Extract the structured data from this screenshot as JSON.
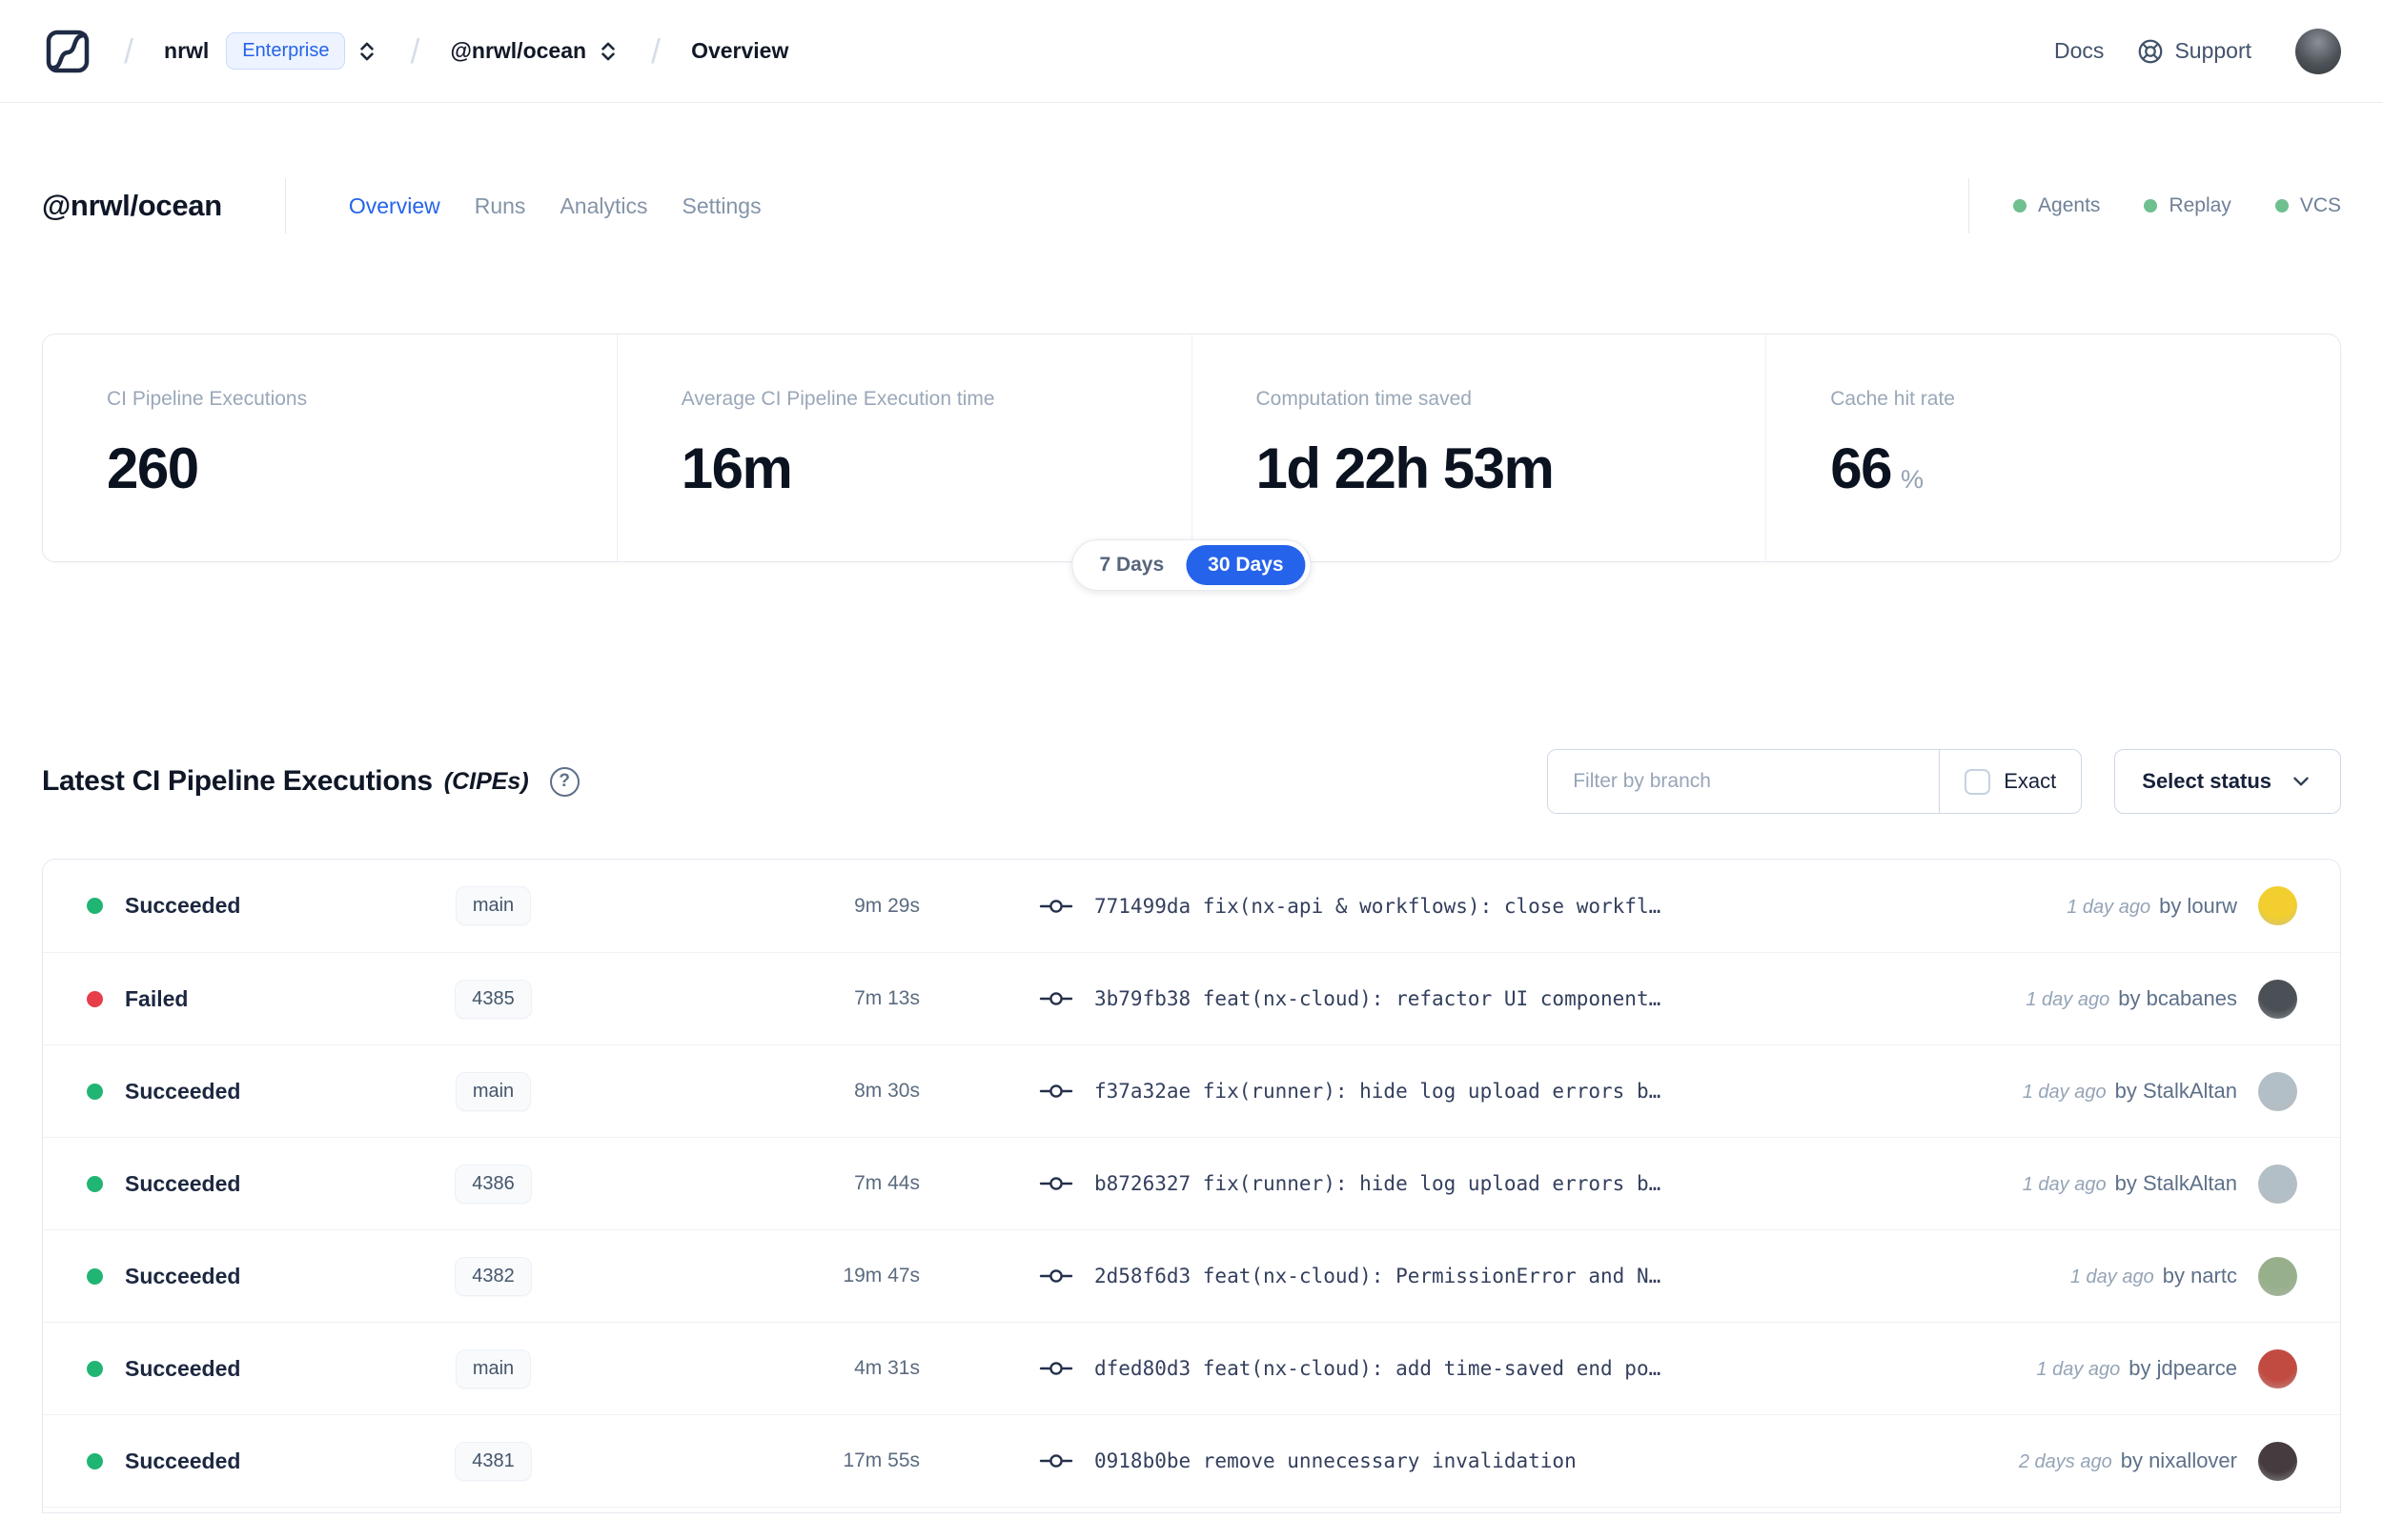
{
  "navbar": {
    "breadcrumb": {
      "org": "nrwl",
      "org_badge": "Enterprise",
      "workspace": "@nrwl/ocean",
      "page": "Overview"
    },
    "links": {
      "docs": "Docs",
      "support": "Support"
    }
  },
  "workspace_header": {
    "title": "@nrwl/ocean",
    "tabs": [
      {
        "label": "Overview",
        "active": true
      },
      {
        "label": "Runs",
        "active": false
      },
      {
        "label": "Analytics",
        "active": false
      },
      {
        "label": "Settings",
        "active": false
      }
    ],
    "statuses": [
      {
        "label": "Agents"
      },
      {
        "label": "Replay"
      },
      {
        "label": "VCS"
      }
    ]
  },
  "stats": {
    "cards": [
      {
        "label": "CI Pipeline Executions",
        "value": "260",
        "suffix": ""
      },
      {
        "label": "Average CI Pipeline Execution time",
        "value": "16m",
        "suffix": ""
      },
      {
        "label": "Computation time saved",
        "value": "1d 22h 53m",
        "suffix": ""
      },
      {
        "label": "Cache hit rate",
        "value": "66",
        "suffix": "%"
      }
    ],
    "range_toggle": {
      "options": [
        "7 Days",
        "30 Days"
      ],
      "selected": "30 Days"
    }
  },
  "cipes": {
    "title": "Latest CI Pipeline Executions",
    "title_suffix": "(CIPEs)",
    "help_glyph": "?",
    "filter": {
      "placeholder": "Filter by branch",
      "exact_label": "Exact",
      "status_label": "Select status"
    },
    "rows": [
      {
        "status": "Succeeded",
        "branch": "main",
        "duration": "9m 29s",
        "commit_hash": "771499da",
        "commit_message": "fix(nx-api & workflows): close workfl…",
        "time": "1 day ago",
        "author": "by lourw",
        "avatar_color": "#f2cf2e"
      },
      {
        "status": "Failed",
        "branch": "4385",
        "duration": "7m 13s",
        "commit_hash": "3b79fb38",
        "commit_message": "feat(nx-cloud): refactor UI component…",
        "time": "1 day ago",
        "author": "by bcabanes",
        "avatar_color": "#4a5056"
      },
      {
        "status": "Succeeded",
        "branch": "main",
        "duration": "8m 30s",
        "commit_hash": "f37a32ae",
        "commit_message": "fix(runner): hide log upload errors b…",
        "time": "1 day ago",
        "author": "by StalkAltan",
        "avatar_color": "#b3bfc7"
      },
      {
        "status": "Succeeded",
        "branch": "4386",
        "duration": "7m 44s",
        "commit_hash": "b8726327",
        "commit_message": "fix(runner): hide log upload errors b…",
        "time": "1 day ago",
        "author": "by StalkAltan",
        "avatar_color": "#b3bfc7"
      },
      {
        "status": "Succeeded",
        "branch": "4382",
        "duration": "19m 47s",
        "commit_hash": "2d58f6d3",
        "commit_message": "feat(nx-cloud): PermissionError and N…",
        "time": "1 day ago",
        "author": "by nartc",
        "avatar_color": "#97b08b"
      },
      {
        "status": "Succeeded",
        "branch": "main",
        "duration": "4m 31s",
        "commit_hash": "dfed80d3",
        "commit_message": "feat(nx-cloud): add time-saved end po…",
        "time": "1 day ago",
        "author": "by jdpearce",
        "avatar_color": "#c24b41"
      },
      {
        "status": "Succeeded",
        "branch": "4381",
        "duration": "17m 55s",
        "commit_hash": "0918b0be",
        "commit_message": "remove unnecessary invalidation",
        "time": "2 days ago",
        "author": "by nixallover",
        "avatar_color": "#463c3f"
      }
    ]
  },
  "colors": {
    "accent_blue": "#2563eb",
    "status_succeeded": "#21b573",
    "status_failed": "#e83e4a",
    "header_status_dot": "#6fbf8f"
  }
}
